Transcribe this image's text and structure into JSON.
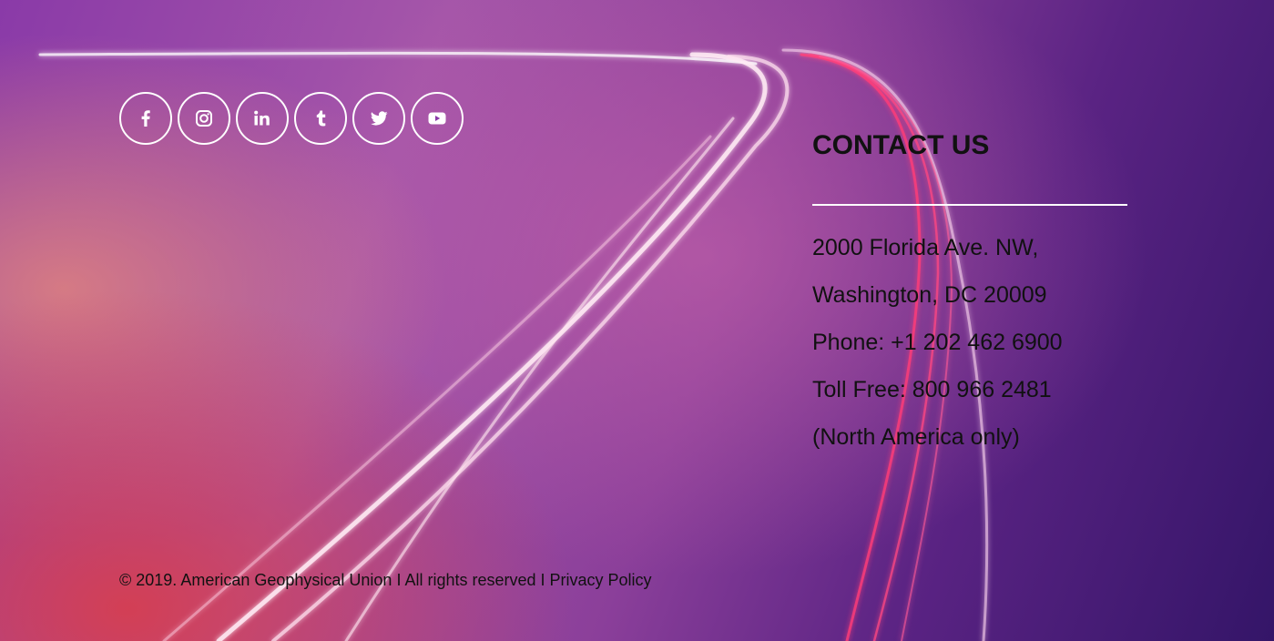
{
  "social": {
    "items": [
      {
        "label": "f",
        "icon": "facebook-icon"
      },
      {
        "label": "instagram",
        "icon": "instagram-icon"
      },
      {
        "label": "in",
        "icon": "linkedin-icon"
      },
      {
        "label": "t",
        "icon": "tumblr-icon"
      },
      {
        "label": "twitter",
        "icon": "twitter-icon"
      },
      {
        "label": "youtube",
        "icon": "youtube-icon"
      }
    ]
  },
  "contact": {
    "heading": "CONTACT US",
    "address_line1": "2000 Florida Ave. NW,",
    "address_line2": "Washington, DC 20009",
    "phone": "Phone: +1 202 462 6900",
    "toll_free": "Toll Free: 800 966 2481",
    "toll_free_note": "(North America only)"
  },
  "legal": {
    "copyright": "© 2019. American Geophysical Union",
    "separator1": " I ",
    "rights": "All rights reserved",
    "separator2": " I ",
    "privacy_link": "Privacy Policy"
  },
  "colors": {
    "text": "#111111",
    "icon": "#ffffff",
    "gradient_left": "#e38a7a",
    "gradient_right": "#341568"
  }
}
